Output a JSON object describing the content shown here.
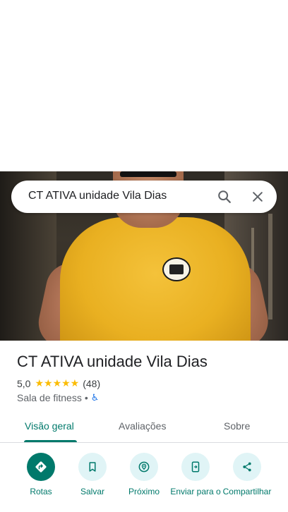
{
  "search": {
    "query": "CT ATIVA unidade Vila Dias"
  },
  "place": {
    "title": "CT ATIVA unidade Vila Dias",
    "rating": "5,0",
    "stars": "★★★★★",
    "reviews": "(48)",
    "category": "Sala de fitness",
    "separator": "•"
  },
  "tabs": [
    {
      "label": "Visão geral",
      "active": true
    },
    {
      "label": "Avaliações",
      "active": false
    },
    {
      "label": "Sobre",
      "active": false
    }
  ],
  "actions": [
    {
      "label": "Rotas",
      "icon": "directions-icon"
    },
    {
      "label": "Salvar",
      "icon": "bookmark-icon"
    },
    {
      "label": "Próximo",
      "icon": "nearby-icon"
    },
    {
      "label": "Enviar para o",
      "icon": "send-to-phone-icon"
    },
    {
      "label": "Compartilhar",
      "icon": "share-icon"
    }
  ],
  "colors": {
    "accent": "#00796b",
    "star": "#fbbc04",
    "action_bg": "#e0f4f6",
    "shirt": "#f4c23a"
  }
}
